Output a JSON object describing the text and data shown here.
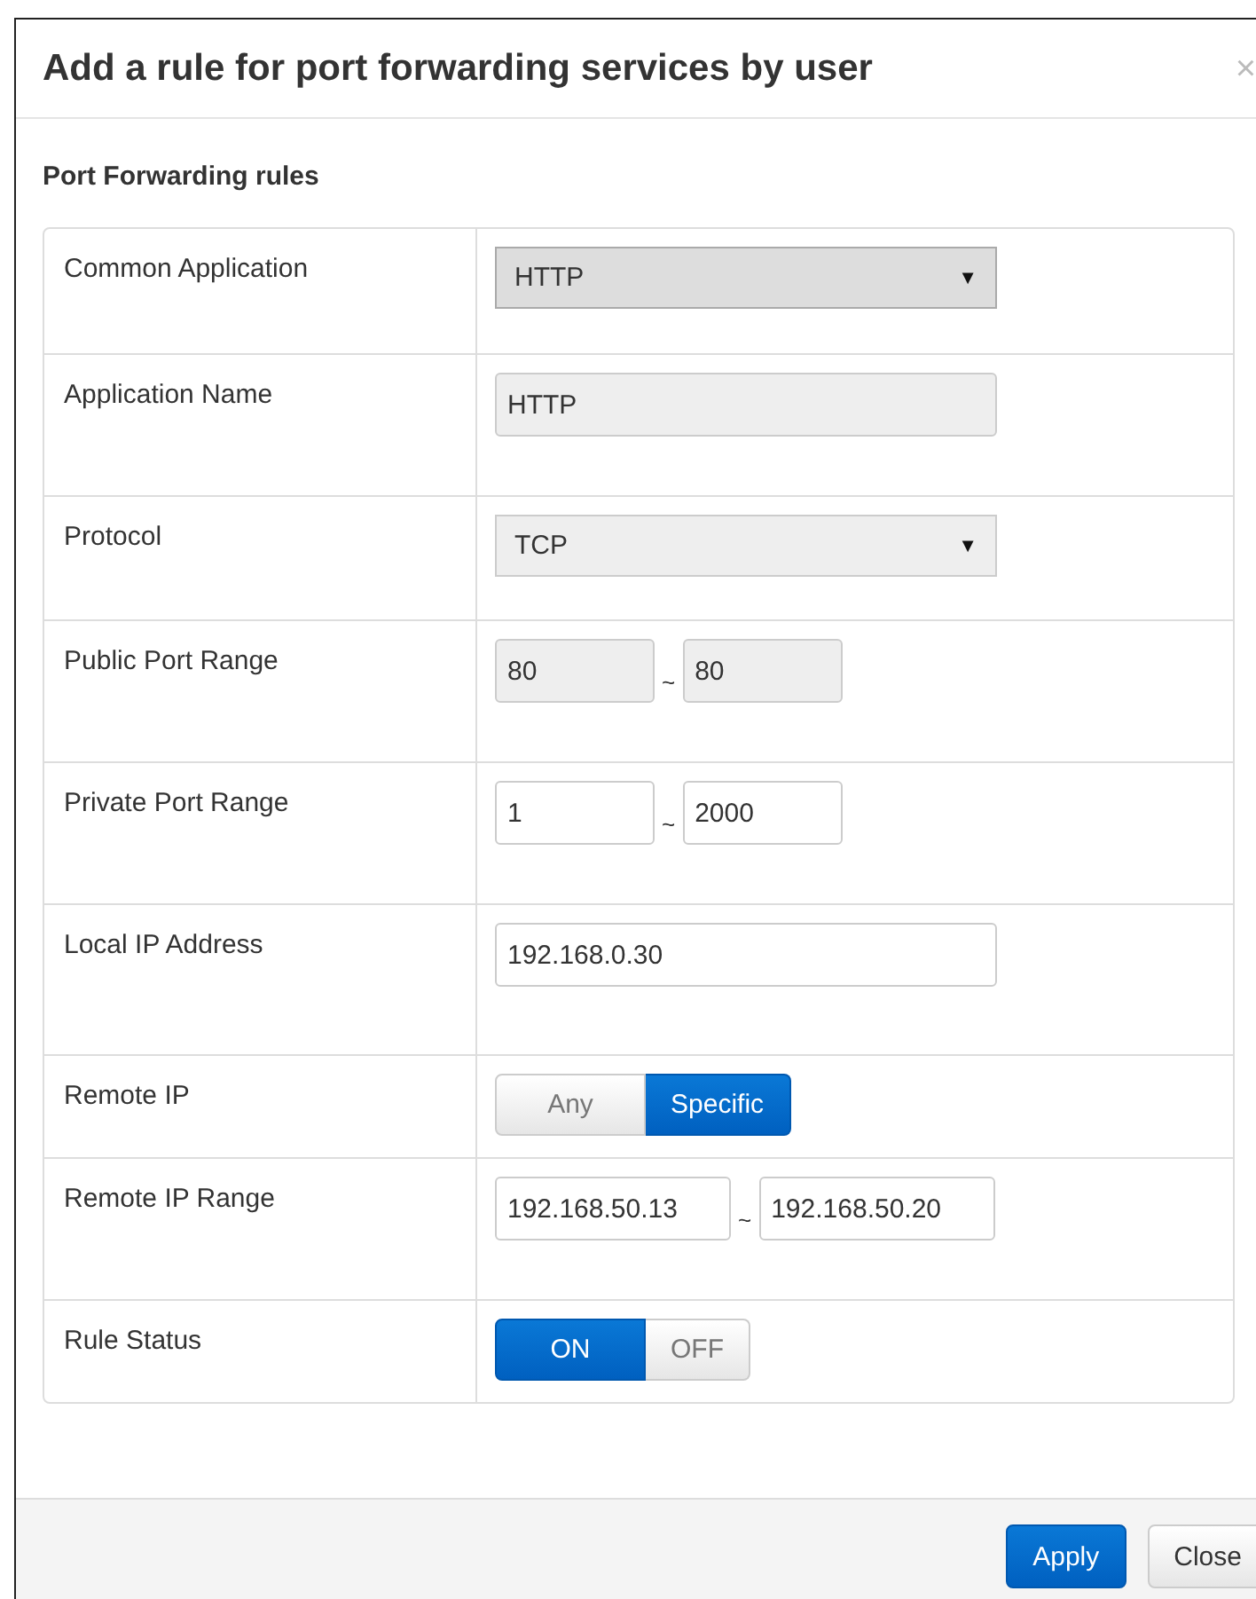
{
  "dialog": {
    "title": "Add a rule for port forwarding services by user",
    "close_symbol": "×"
  },
  "section_title": "Port Forwarding rules",
  "rows": [
    {
      "label": "Common Application",
      "kind": "select",
      "value": "HTTP",
      "caret": "▼",
      "highlighted": true
    },
    {
      "label": "Application Name",
      "kind": "text",
      "value": "HTTP",
      "disabled": true
    },
    {
      "label": "Protocol",
      "kind": "select",
      "value": "TCP",
      "caret": "▼",
      "highlighted": false
    },
    {
      "label": "Public Port Range",
      "kind": "range",
      "from": "80",
      "separator": "~",
      "to": "80",
      "disabled": true,
      "wide": false
    },
    {
      "label": "Private Port Range",
      "kind": "range",
      "from": "1",
      "separator": "~",
      "to": "2000",
      "disabled": false,
      "wide": false
    },
    {
      "label": "Local IP Address",
      "kind": "text",
      "value": "192.168.0.30",
      "disabled": false
    },
    {
      "label": "Remote IP",
      "kind": "segmented",
      "options": [
        {
          "label": "Any",
          "selected": false
        },
        {
          "label": "Specific",
          "selected": true
        }
      ]
    },
    {
      "label": "Remote IP Range",
      "kind": "range",
      "from": "192.168.50.13",
      "separator": "~",
      "to": "192.168.50.20",
      "disabled": false,
      "wide": true
    },
    {
      "label": "Rule Status",
      "kind": "segmented",
      "options": [
        {
          "label": "ON",
          "selected": true
        },
        {
          "label": "OFF",
          "selected": false
        }
      ]
    }
  ],
  "buttons": [
    {
      "label": "Apply",
      "primary": true
    },
    {
      "label": "Close",
      "primary": false
    }
  ]
}
